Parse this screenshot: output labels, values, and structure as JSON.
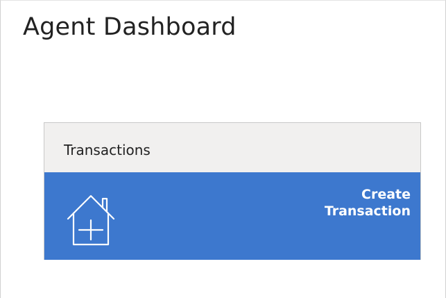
{
  "page": {
    "title": "Agent Dashboard"
  },
  "transactions_card": {
    "title": "Transactions",
    "action": {
      "label_line1": "Create",
      "label_line2": "Transaction",
      "icon": "house-plus-icon"
    }
  },
  "colors": {
    "accent": "#3d78ce",
    "header_bg": "#f1f0ef",
    "title_text": "#222222",
    "tile_text": "#ffffff"
  }
}
